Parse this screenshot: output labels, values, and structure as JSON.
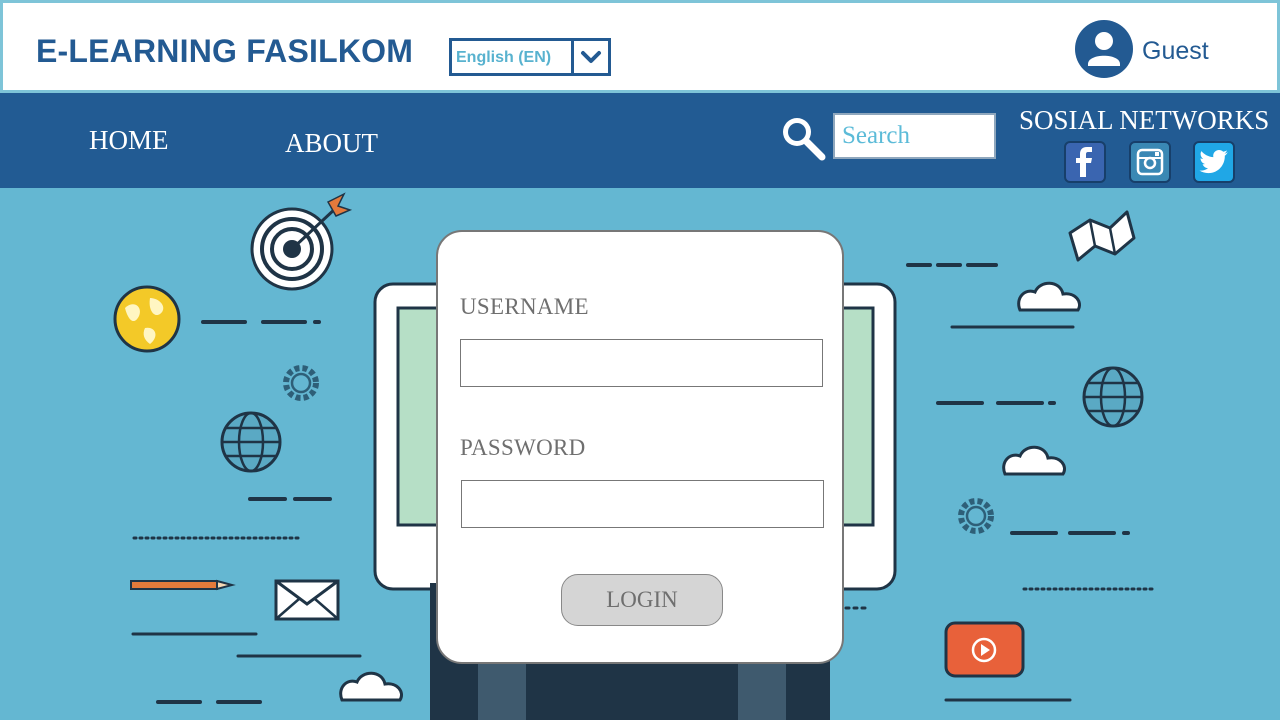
{
  "header": {
    "brand": "E-LEARNING FASILKOM",
    "language": {
      "selected": "English (EN)"
    },
    "user": {
      "name": "Guest"
    }
  },
  "nav": {
    "items": [
      {
        "label": "HOME"
      },
      {
        "label": "ABOUT"
      }
    ],
    "search": {
      "placeholder": "Search"
    },
    "social": {
      "title": "SOSIAL NETWORKS",
      "links": [
        {
          "icon": "facebook-icon"
        },
        {
          "icon": "instagram-icon"
        },
        {
          "icon": "twitter-icon"
        }
      ]
    }
  },
  "login": {
    "username_label": "USERNAME",
    "username_value": "",
    "password_label": "PASSWORD",
    "password_value": "",
    "button_label": "LOGIN"
  },
  "colors": {
    "primary": "#225b93",
    "background": "#64b7d2",
    "accent": "#58b2cf",
    "button": "#d5d5d5"
  }
}
